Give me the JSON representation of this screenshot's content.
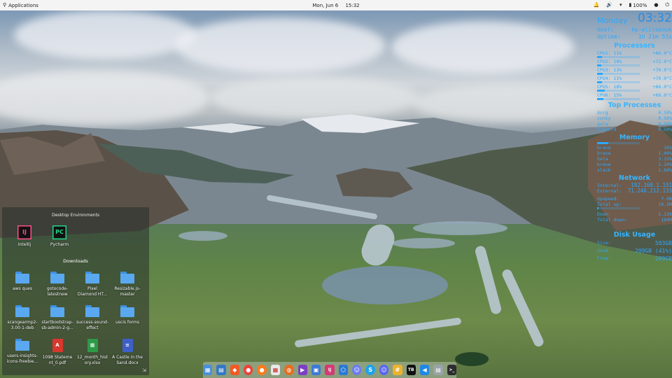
{
  "top_panel": {
    "apps_label": "Applications",
    "date": "Mon, Jun  6",
    "time": "15:32",
    "battery": "100%"
  },
  "conky": {
    "day": "Monday",
    "clock": "03:32",
    "host_label": "Host:",
    "host_value": "hp-elitebook",
    "uptime_label": "Uptime:",
    "uptime_value": "1h 21m 51s",
    "processors_title": "Processors",
    "cpus": [
      {
        "label": "CPU1: 11%",
        "temp": "+66.0°C",
        "pct": 11
      },
      {
        "label": "CPU2: 10%",
        "temp": "+72.0°C",
        "pct": 10
      },
      {
        "label": "CPU3: 13%",
        "temp": "+70.0°C",
        "pct": 13
      },
      {
        "label": "CPU4: 11%",
        "temp": "+70.0°C",
        "pct": 11
      },
      {
        "label": "CPU5: 18%",
        "temp": "+66.0°C",
        "pct": 18
      },
      {
        "label": "CPU6: 15%",
        "temp": "+66.0°C",
        "pct": 15
      }
    ],
    "top_title": "Top Processes",
    "top": [
      {
        "name": "Xorg",
        "pct": "0.59%"
      },
      {
        "name": "conky",
        "pct": "0.56%"
      },
      {
        "name": "gala",
        "pct": "0.50%"
      },
      {
        "name": "discord",
        "pct": "0.50%"
      }
    ],
    "memory_title": "Memory",
    "memory": [
      {
        "name": "brave",
        "pct": "26%"
      },
      {
        "name": "brave",
        "pct": "1.00%"
      },
      {
        "name": "Gala",
        "pct": "3.33%"
      },
      {
        "name": "brave",
        "pct": "2.10%"
      },
      {
        "name": "slack",
        "pct": "1.84%"
      }
    ],
    "network_title": "Network",
    "internal_label": "Internal:",
    "internal_ip": "192.168.1.151",
    "external_label": "External:",
    "external_ip": "71.246.212.133",
    "up_label": "Upspeed:",
    "up_value": "7.0B",
    "total_up_label": "Total up:",
    "total_up_value": "10.5M",
    "down_label": "Down:",
    "down_value": "1.12K",
    "total_down_label": "Total down:",
    "total_down_value": "184M",
    "disk_title": "Disk Usage",
    "size_label": "Size:",
    "size_value": "503GB",
    "used_label": "Used:",
    "used_value": "209GB (41%)",
    "free_label": "Free:",
    "free_value": "269GB"
  },
  "desktop": {
    "panel_title": "Desktop Environments",
    "ide_items": [
      {
        "label": "Intellij",
        "glyph": "IJ"
      },
      {
        "label": "Pycharm",
        "glyph": "PC"
      }
    ],
    "downloads_title": "Downloads",
    "items": [
      [
        "aws ques"
      ],
      [
        "gotocode-",
        "latestnew"
      ],
      [
        "Pixel",
        "Diamond HT..."
      ],
      [
        "Resizable.js-",
        "master"
      ],
      [
        "scangearmp2-",
        "3.00-1-deb"
      ],
      [
        "startbootstrap-",
        "sb-admin-2-g..."
      ],
      [
        "success-sound-",
        "effect"
      ],
      [
        "uscis forms"
      ],
      [
        "users-insights-",
        "icons-freebie..."
      ],
      [
        "1098 Stateme",
        "nt_0.pdf"
      ],
      [
        "12_month_hist",
        "ory.xlsx"
      ],
      [
        "A Castle in the",
        "Sand.docx"
      ]
    ],
    "item_kinds": [
      "folder",
      "folder",
      "folder",
      "folder",
      "folder",
      "folder",
      "folder",
      "folder",
      "folder",
      "pdf",
      "xlsx",
      "docx"
    ]
  },
  "dock": {
    "items": [
      "multitasking-view",
      "files",
      "brave",
      "chrome",
      "firefox",
      "calendar",
      "ubuntu-software",
      "media-player",
      "app-store",
      "intellij",
      "sourcetree",
      "discord-alt",
      "skype",
      "discord",
      "slack",
      "jetbrains-toolbox",
      "vscode",
      "system-monitor",
      "terminal"
    ]
  }
}
